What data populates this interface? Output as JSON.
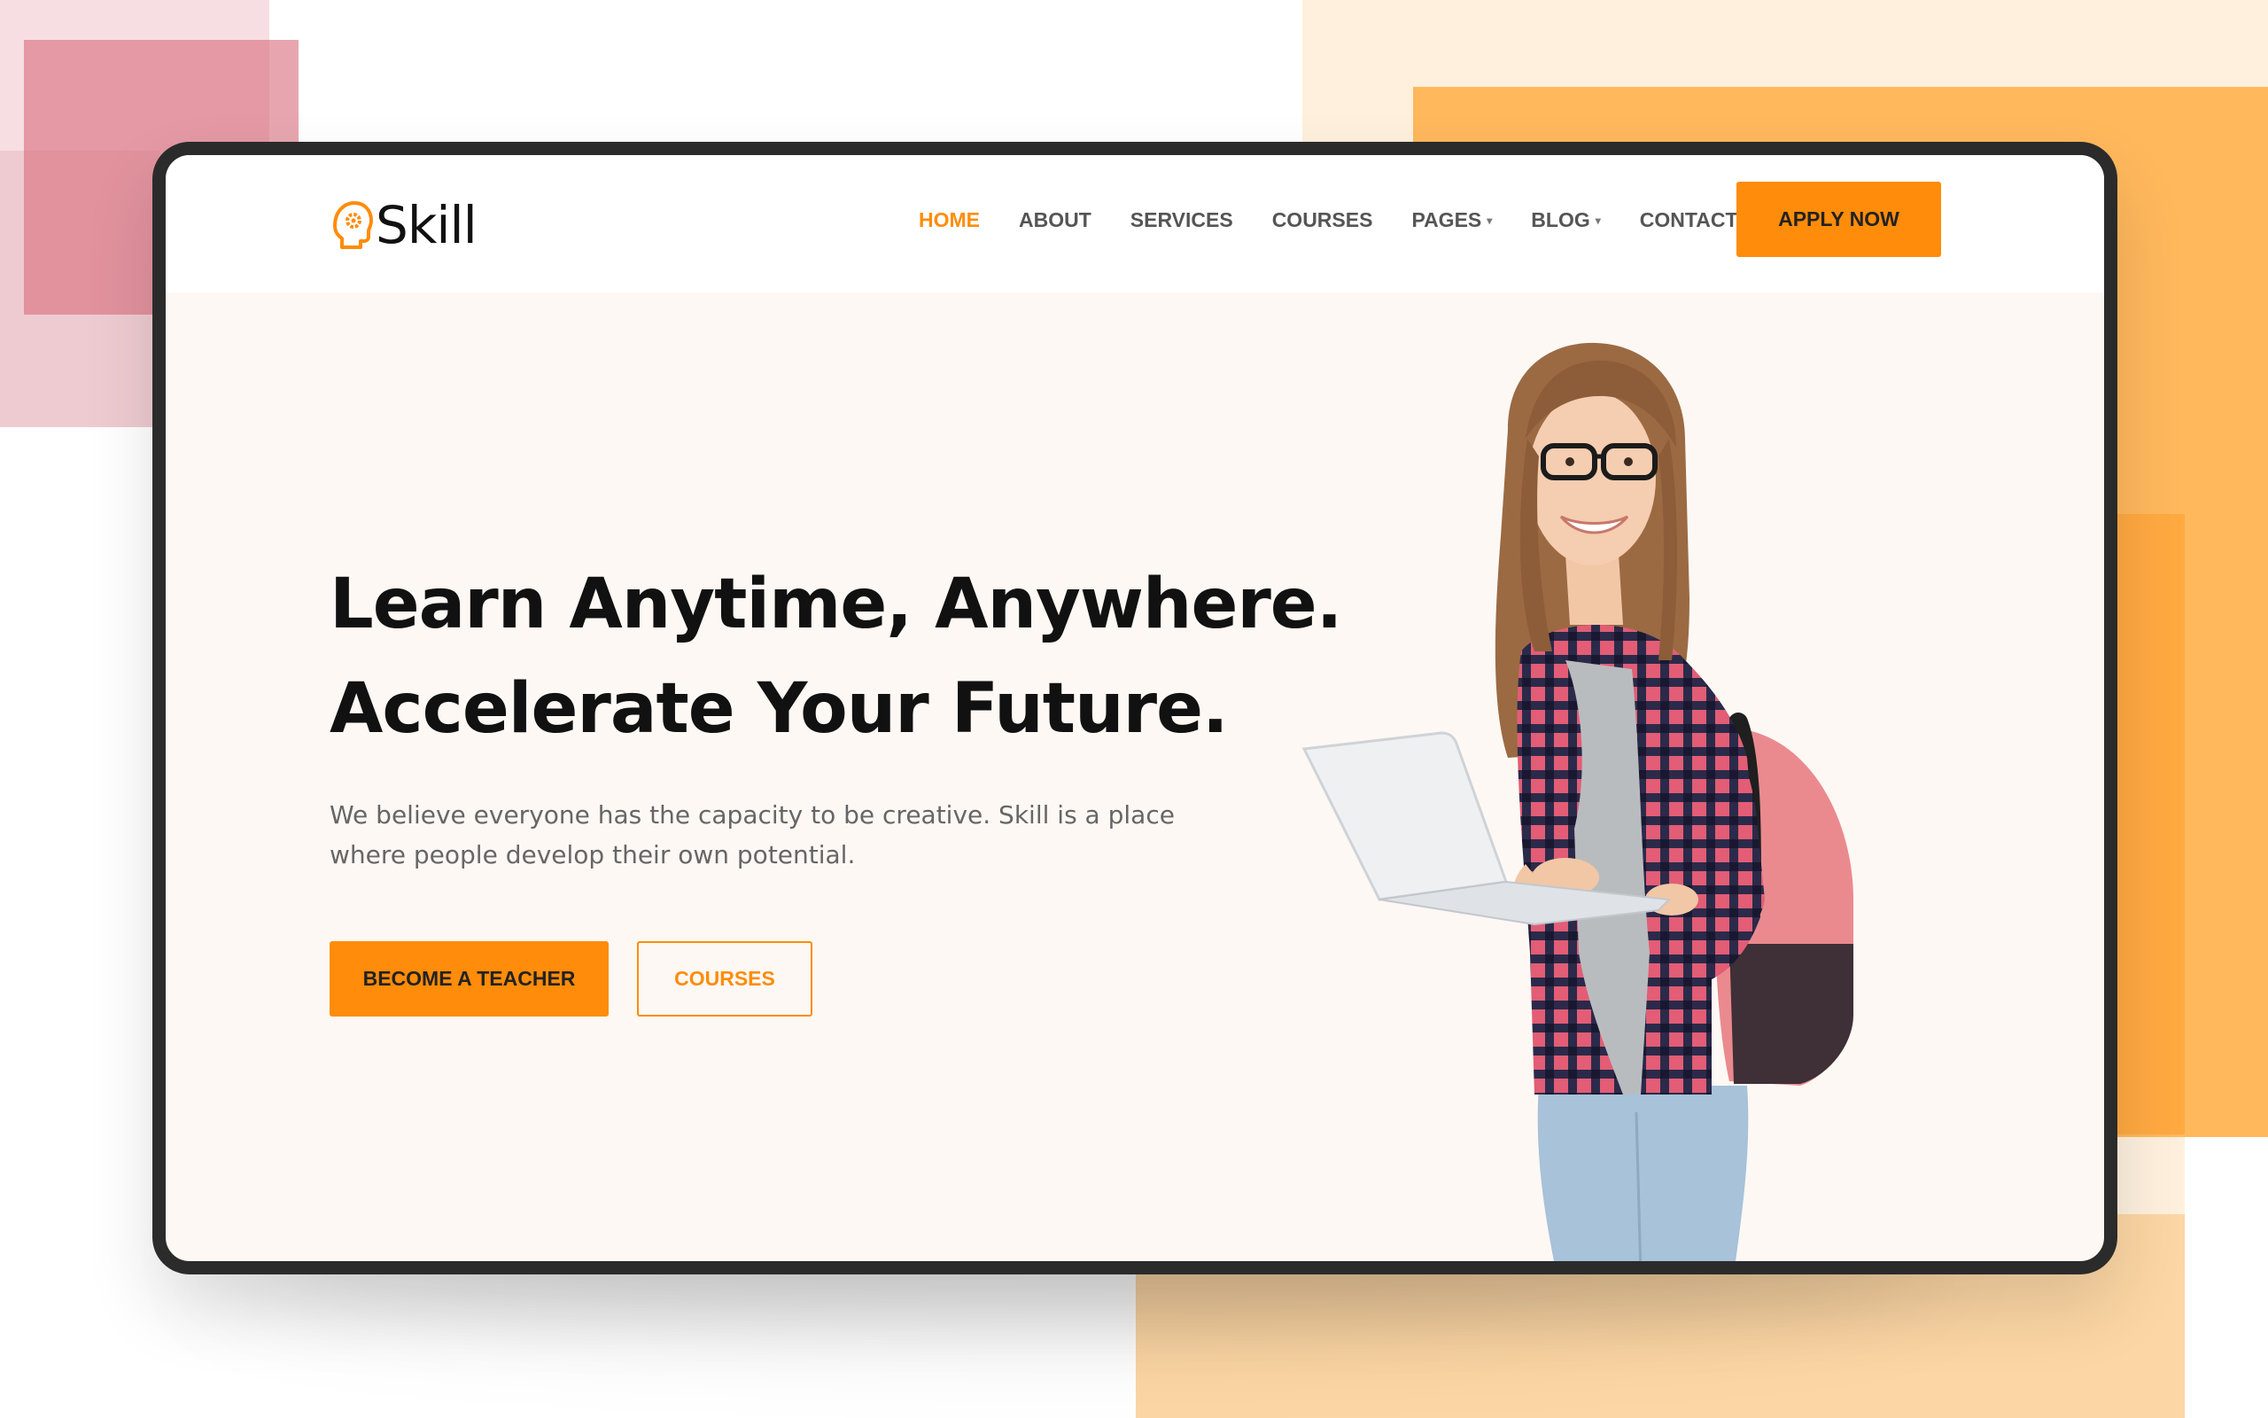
{
  "brand": {
    "name": "Skill",
    "accent_color": "#ff8c0a",
    "logo_icon": "head-gear-icon"
  },
  "nav": {
    "items": [
      {
        "label": "HOME",
        "active": true,
        "has_dropdown": false
      },
      {
        "label": "ABOUT",
        "active": false,
        "has_dropdown": false
      },
      {
        "label": "SERVICES",
        "active": false,
        "has_dropdown": false
      },
      {
        "label": "COURSES",
        "active": false,
        "has_dropdown": false
      },
      {
        "label": "PAGES",
        "active": false,
        "has_dropdown": true
      },
      {
        "label": "BLOG",
        "active": false,
        "has_dropdown": true
      },
      {
        "label": "CONTACT",
        "active": false,
        "has_dropdown": false
      }
    ],
    "cta_label": "APPLY NOW"
  },
  "hero": {
    "title_line1": "Learn Anytime, Anywhere.",
    "title_line2": "Accelerate Your Future.",
    "description": "We believe everyone has the capacity to be creative. Skill is a place where people develop their own potential.",
    "primary_button": "BECOME A TEACHER",
    "secondary_button": "COURSES",
    "image": "student-with-laptop-and-backpack"
  }
}
